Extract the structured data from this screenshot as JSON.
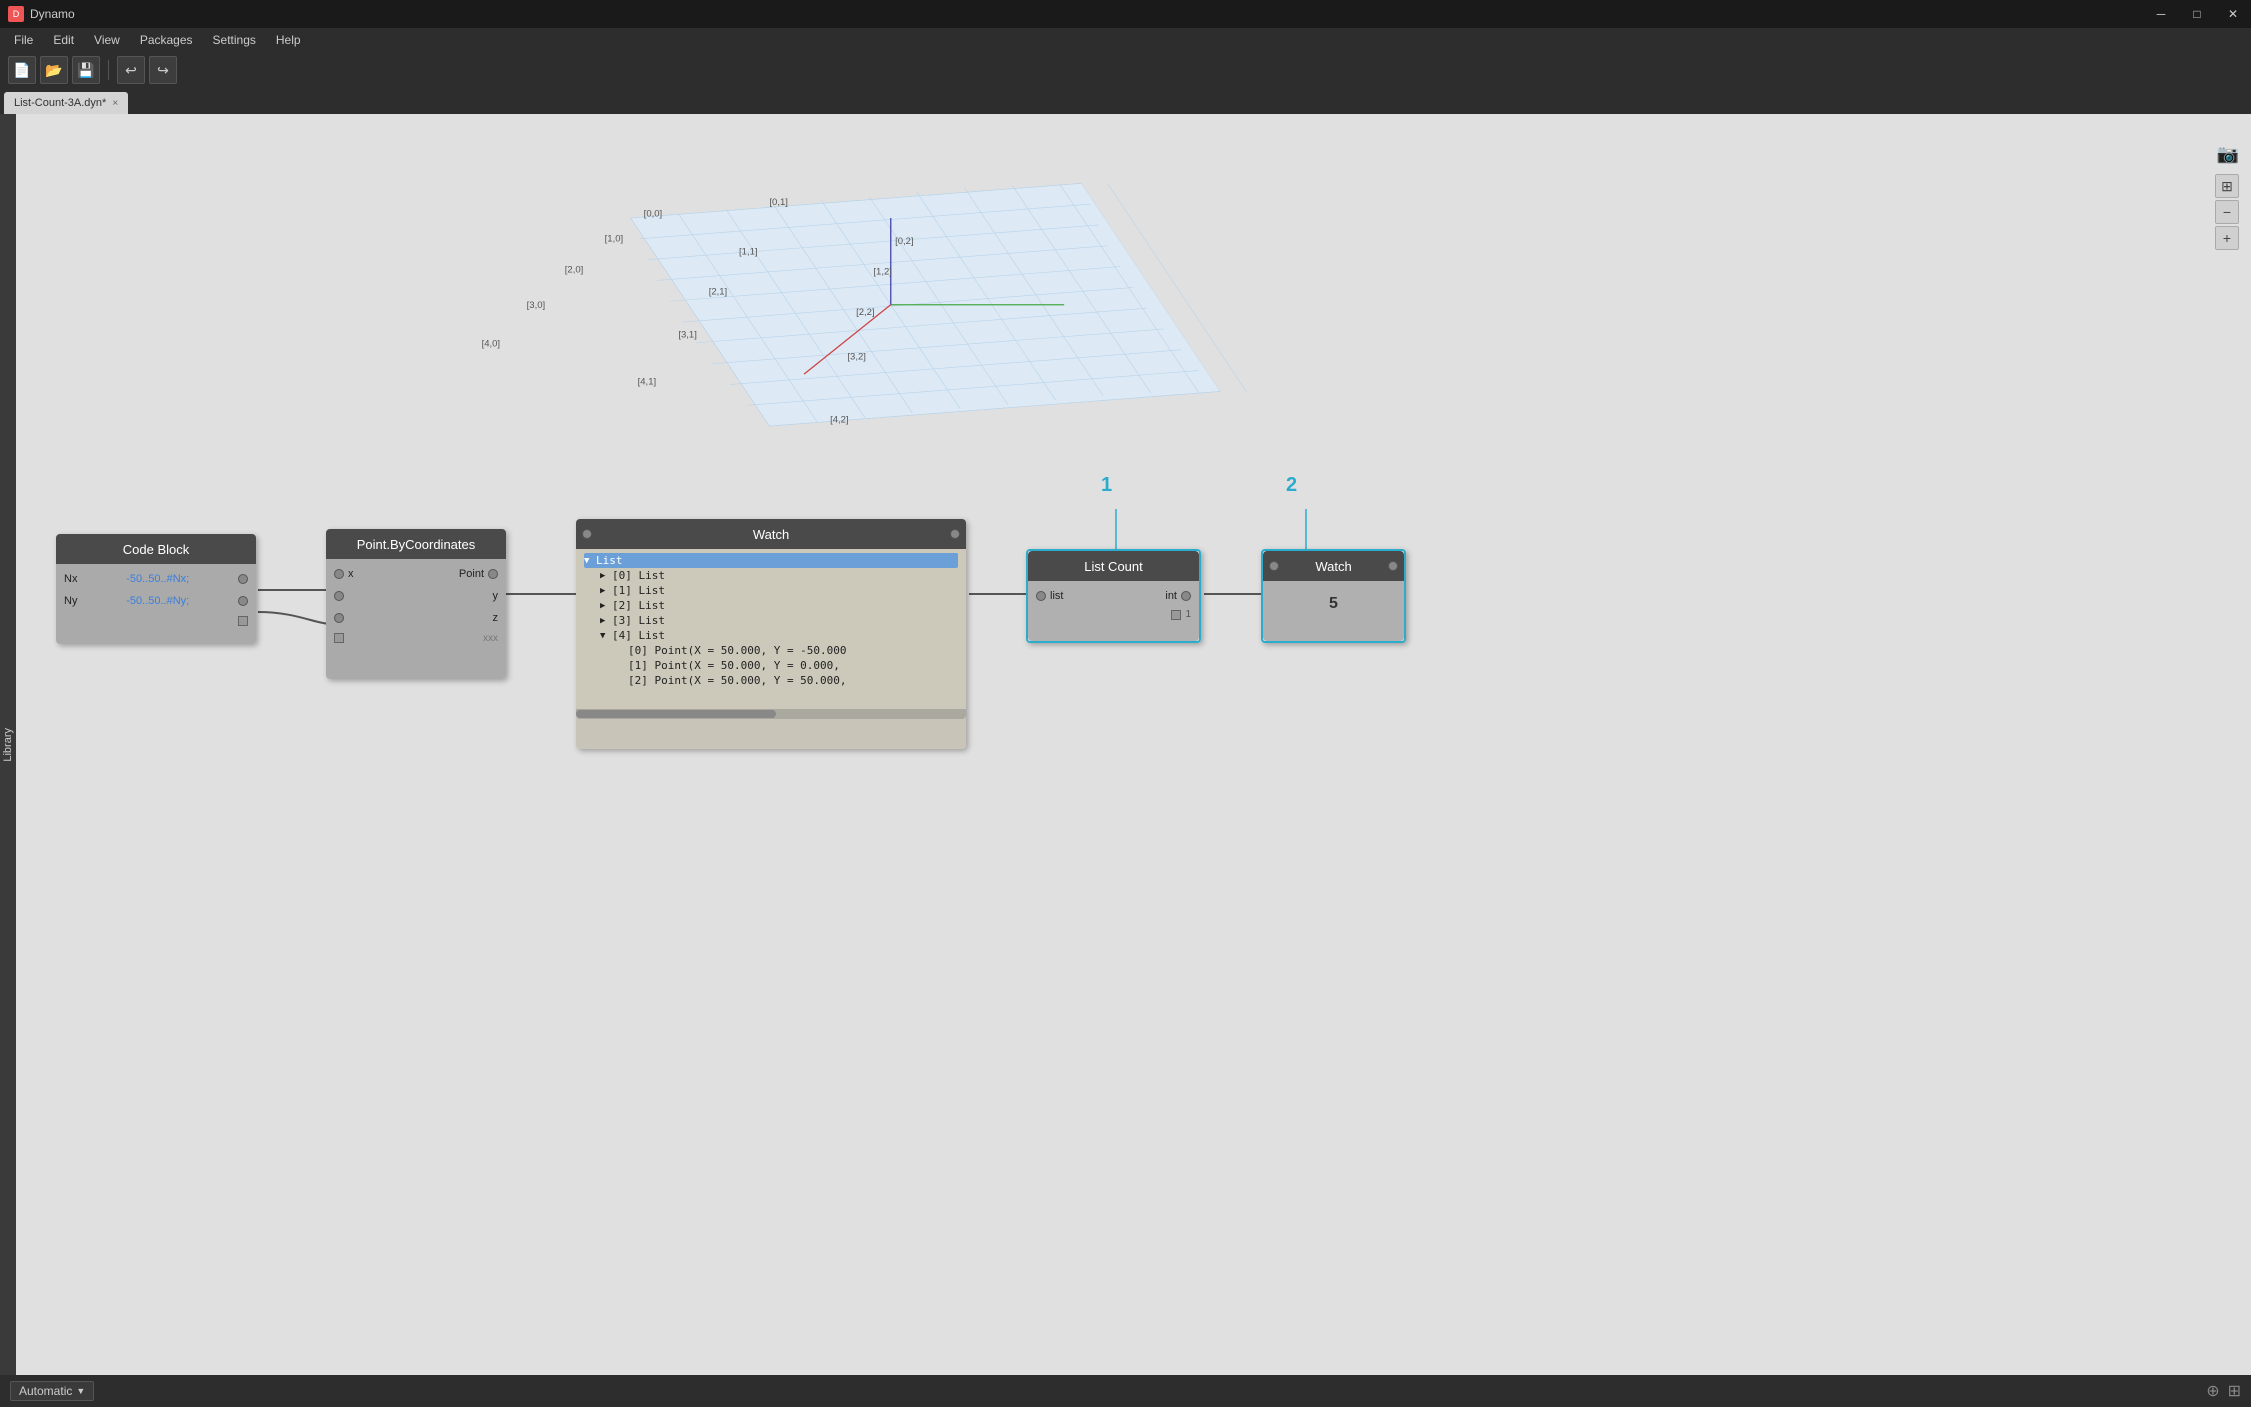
{
  "app": {
    "title": "Dynamo",
    "window_controls": [
      "minimize",
      "maximize",
      "close"
    ]
  },
  "menubar": {
    "items": [
      "File",
      "Edit",
      "View",
      "Packages",
      "Settings",
      "Help"
    ]
  },
  "toolbar": {
    "buttons": [
      "new",
      "open",
      "save",
      "undo",
      "redo"
    ]
  },
  "tab": {
    "label": "List-Count-3A.dyn*",
    "close": "×"
  },
  "sidebar": {
    "label": "Library"
  },
  "nodes": {
    "codeblock": {
      "title": "Code Block",
      "rows": [
        {
          "label": "Nx",
          "value": "-50..50..#Nx;"
        },
        {
          "label": "Ny",
          "value": "-50..50..#Ny;"
        }
      ]
    },
    "point_by_coords": {
      "title": "Point.ByCoordinates",
      "inputs": [
        "x",
        "y",
        "z"
      ],
      "output": "Point",
      "footer": "xxx"
    },
    "watch_main": {
      "title": "Watch",
      "tree": {
        "items": [
          {
            "level": 0,
            "arrow": "▼",
            "label": "List",
            "selected": true
          },
          {
            "level": 1,
            "arrow": "▶",
            "label": "[0] List",
            "selected": false
          },
          {
            "level": 1,
            "arrow": "▶",
            "label": "[1] List",
            "selected": false
          },
          {
            "level": 1,
            "arrow": "▶",
            "label": "[2] List",
            "selected": false
          },
          {
            "level": 1,
            "arrow": "▶",
            "label": "[3] List",
            "selected": false
          },
          {
            "level": 1,
            "arrow": "▼",
            "label": "[4] List",
            "selected": false
          },
          {
            "level": 2,
            "arrow": "",
            "label": "[0] Point(X = 50.000, Y = -50.000",
            "selected": false
          },
          {
            "level": 2,
            "arrow": "",
            "label": "[1] Point(X = 50.000, Y = 0.000,",
            "selected": false
          },
          {
            "level": 2,
            "arrow": "",
            "label": "[2] Point(X = 50.000, Y = 50.000,",
            "selected": false
          }
        ]
      }
    },
    "list_count": {
      "title": "List Count",
      "callout_num": "1",
      "inputs": [
        {
          "label": "list"
        }
      ],
      "outputs": [
        {
          "label": "int"
        }
      ],
      "checkbox": true,
      "checkbox_value": "1"
    },
    "watch2": {
      "title": "Watch",
      "callout_num": "2",
      "output_value": "5"
    }
  },
  "grid": {
    "point_labels": [
      "[0,0]",
      "[0,1]",
      "[0,2]",
      "[1,0]",
      "[1,1]",
      "[1,2]",
      "[2,0]",
      "[2,1]",
      "[2,2]",
      "[3,0]",
      "[3,1]",
      "[3,2]",
      "[4,0]",
      "[4,1]",
      "[4,2]",
      "[4,2]"
    ]
  },
  "bottombar": {
    "run_mode": "Automatic",
    "run_arrow": "▼"
  },
  "zoom": {
    "fit": "⊞",
    "minus": "−",
    "plus": "+"
  }
}
